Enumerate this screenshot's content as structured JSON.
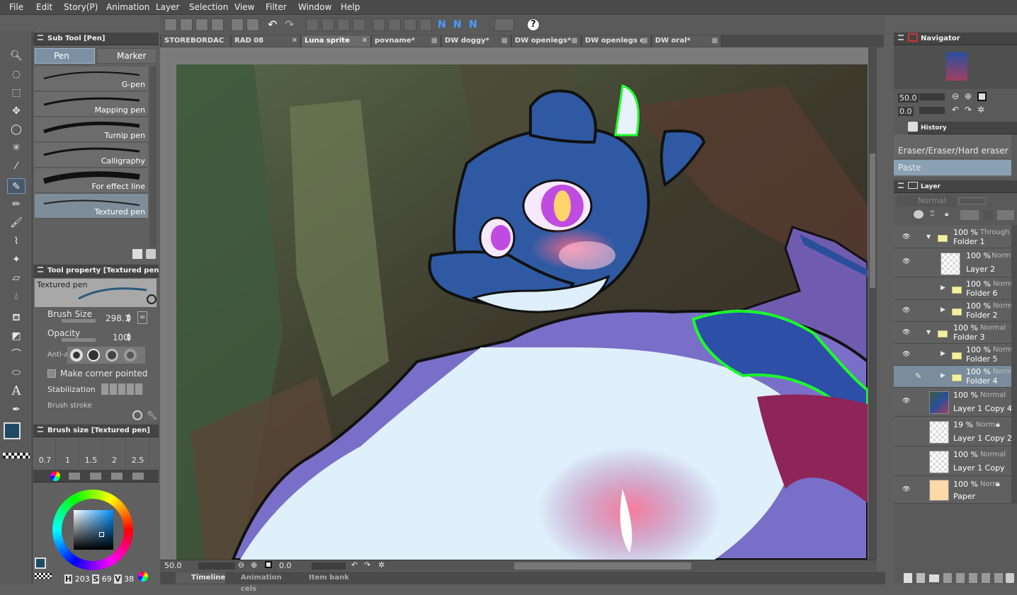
{
  "menu": [
    "File",
    "Edit",
    "Story(P)",
    "Animation",
    "Layer",
    "Selection",
    "View",
    "Filter",
    "Window",
    "Help"
  ],
  "subtool": {
    "title": "Sub Tool [Pen]",
    "tabs": [
      "Pen",
      "Marker"
    ],
    "brushes": [
      "G-pen",
      "Mapping pen",
      "Turnip pen",
      "Calligraphy",
      "For effect line",
      "Textured pen"
    ]
  },
  "toolprop": {
    "title": "Tool property [Textured pen",
    "preview_label": "Textured pen",
    "brush_size_label": "Brush Size",
    "brush_size_value": "298.1",
    "opacity_label": "Opacity",
    "opacity_value": "100",
    "antialias_label": "Anti-a",
    "corner_label": "Make corner pointed",
    "stabilization_label": "Stabilization",
    "brush_stroke_label": "Brush stroke"
  },
  "brushsize": {
    "title": "Brush size [Textured pen]",
    "sizes": [
      "0.7",
      "1",
      "1.5",
      "2",
      "2.5"
    ]
  },
  "color": {
    "h": "203",
    "s": "69",
    "v": "38",
    "main_color": "#1e4a66"
  },
  "doc_tabs": [
    "STOREBORDAC",
    "RAD 08",
    "Luna sprite",
    "povname*",
    "DW doggy*",
    "DW openlegs*",
    "DW openlegs c",
    "DW oral*"
  ],
  "active_tab": "Luna sprite",
  "status": {
    "zoom": "50.0",
    "angle": "0.0"
  },
  "timeline_tabs": [
    "Timeline",
    "Animation cels",
    "Item bank"
  ],
  "navigator": {
    "title": "Navigator",
    "zoom": "50.0",
    "angle": "0.0"
  },
  "history": {
    "title": "History",
    "items": [
      "Eraser/Eraser/Hard eraser",
      "Paste"
    ]
  },
  "layer_panel": {
    "title": "Layer",
    "blend_mode": "Normal",
    "layers": [
      {
        "pct": "100 %",
        "mode": "Through",
        "name": "Folder 1",
        "type": "folder",
        "indent": 0,
        "open": true
      },
      {
        "pct": "100 %",
        "mode": "Norm",
        "name": "Layer 2",
        "type": "raster",
        "indent": 1
      },
      {
        "pct": "100 %",
        "mode": "Norm",
        "name": "Folder 6",
        "type": "folder",
        "indent": 1,
        "open": false
      },
      {
        "pct": "100 %",
        "mode": "Norm",
        "name": "Folder 2",
        "type": "folder",
        "indent": 1,
        "open": false
      },
      {
        "pct": "100 %",
        "mode": "Normal",
        "name": "Folder 3",
        "type": "folder",
        "indent": 0,
        "open": true
      },
      {
        "pct": "100 %",
        "mode": "Norm",
        "name": "Folder 5",
        "type": "folder",
        "indent": 1,
        "open": false
      },
      {
        "pct": "100 %",
        "mode": "Norm",
        "name": "Folder 4",
        "type": "folder",
        "indent": 1,
        "open": false
      },
      {
        "pct": "100 %",
        "mode": "Normal",
        "name": "Layer 1 Copy 4",
        "type": "image",
        "indent": 0
      },
      {
        "pct": "19 %",
        "mode": "Norm",
        "name": "Layer 1 Copy 2",
        "type": "raster",
        "indent": 0
      },
      {
        "pct": "100 %",
        "mode": "Normal",
        "name": "Layer 1 Copy",
        "type": "raster",
        "indent": 0
      },
      {
        "pct": "100 %",
        "mode": "Norm",
        "name": "Paper",
        "type": "paper",
        "indent": 0
      }
    ]
  }
}
